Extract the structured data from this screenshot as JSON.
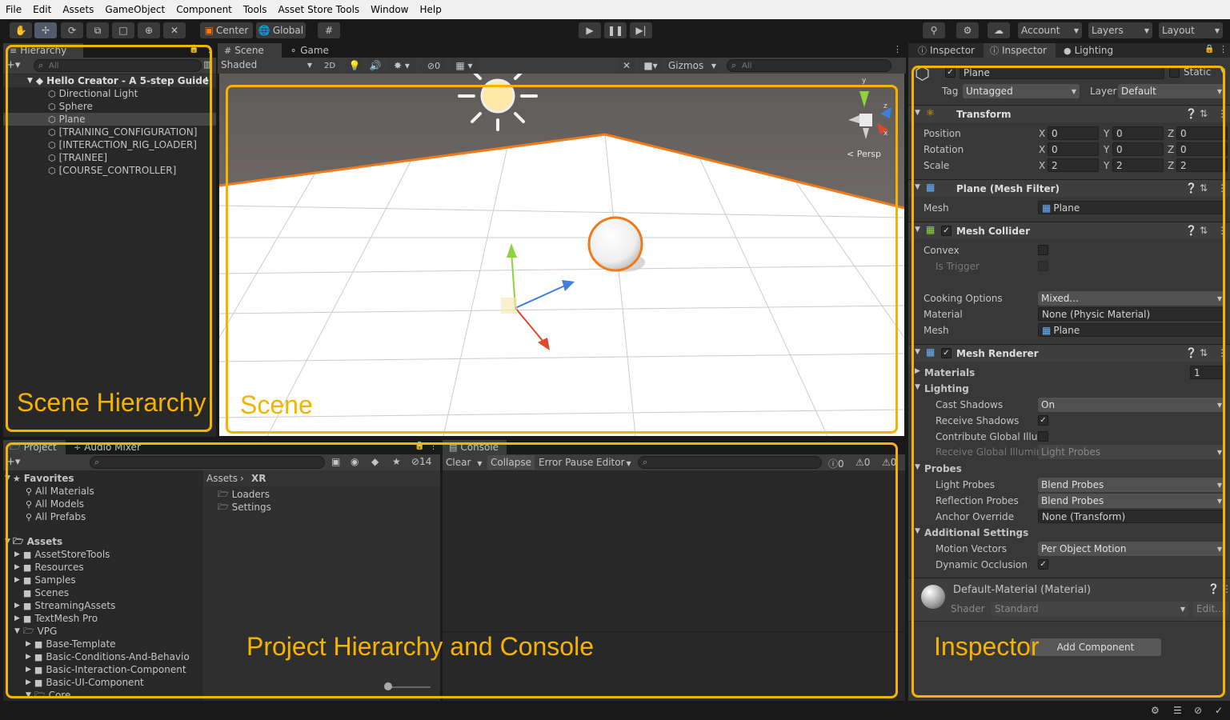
{
  "menu": [
    "File",
    "Edit",
    "Assets",
    "GameObject",
    "Component",
    "Tools",
    "Asset Store Tools",
    "Window",
    "Help"
  ],
  "toolbar": {
    "center_label": "Center",
    "global_label": "Global",
    "account_label": "Account",
    "layers_label": "Layers",
    "layout_label": "Layout"
  },
  "hierarchy": {
    "tab": "Hierarchy",
    "search_placeholder": "All",
    "scene_name": "Hello Creator - A 5-step Guide",
    "items": [
      "Directional Light",
      "Sphere",
      "Plane",
      "[TRAINING_CONFIGURATION]",
      "[INTERACTION_RIG_LOADER]",
      "[TRAINEE]",
      "[COURSE_CONTROLLER]"
    ],
    "selected_item": "Plane"
  },
  "scene": {
    "tabs": [
      "Scene",
      "Game"
    ],
    "shading": "Shaded",
    "mode_2d": "2D",
    "hidden_count": "0",
    "gizmos": "Gizmos",
    "search_placeholder": "All",
    "persp": "< Persp",
    "axis_x": "x",
    "axis_y": "y",
    "axis_z": "z"
  },
  "project": {
    "tabs": [
      "Project",
      "Audio Mixer"
    ],
    "hidden_count": "14",
    "favorites_label": "Favorites",
    "favorites": [
      "All Materials",
      "All Models",
      "All Prefabs"
    ],
    "assets_label": "Assets",
    "assets": [
      "AssetStoreTools",
      "Resources",
      "Samples",
      "Scenes",
      "StreamingAssets",
      "TextMesh Pro"
    ],
    "vpg_label": "VPG",
    "vpg_children": [
      "Base-Template",
      "Basic-Conditions-And-Behavio",
      "Basic-Interaction-Component",
      "Basic-UI-Component",
      "Core"
    ],
    "breadcrumb": [
      "Assets",
      "XR"
    ],
    "folder_items": [
      "Loaders",
      "Settings"
    ]
  },
  "console": {
    "tab": "Console",
    "clear": "Clear",
    "collapse": "Collapse",
    "error_pause": "Error Pause",
    "editor": "Editor",
    "count_info": "0",
    "count_warn": "0",
    "count_error": "0"
  },
  "inspector": {
    "tabs": [
      "Inspector",
      "Inspector",
      "Lighting"
    ],
    "object_name": "Plane",
    "static_label": "Static",
    "tag_label": "Tag",
    "tag_value": "Untagged",
    "layer_label": "Layer",
    "layer_value": "Default",
    "transform": {
      "title": "Transform",
      "position_label": "Position",
      "position": [
        "0",
        "0",
        "0"
      ],
      "rotation_label": "Rotation",
      "rotation": [
        "0",
        "0",
        "0"
      ],
      "scale_label": "Scale",
      "scale": [
        "2",
        "2",
        "2"
      ],
      "x": "X",
      "y": "Y",
      "z": "Z"
    },
    "mesh_filter": {
      "title": "Plane (Mesh Filter)",
      "mesh_label": "Mesh",
      "mesh_value": "Plane"
    },
    "mesh_collider": {
      "title": "Mesh Collider",
      "convex_label": "Convex",
      "is_trigger_label": "Is Trigger",
      "cooking_label": "Cooking Options",
      "cooking_value": "Mixed...",
      "material_label": "Material",
      "material_value": "None (Physic Material)",
      "mesh_label": "Mesh",
      "mesh_value": "Plane"
    },
    "mesh_renderer": {
      "title": "Mesh Renderer",
      "materials_label": "Materials",
      "materials_count": "1",
      "lighting_label": "Lighting",
      "cast_shadows_label": "Cast Shadows",
      "cast_shadows_value": "On",
      "receive_shadows_label": "Receive Shadows",
      "contribute_gi_label": "Contribute Global Illum",
      "receive_gi_label": "Receive Global Illumin:",
      "receive_gi_value": "Light Probes",
      "probes_label": "Probes",
      "light_probes_label": "Light Probes",
      "light_probes_value": "Blend Probes",
      "reflection_probes_label": "Reflection Probes",
      "reflection_probes_value": "Blend Probes",
      "anchor_label": "Anchor Override",
      "anchor_value": "None (Transform)",
      "additional_label": "Additional Settings",
      "motion_vectors_label": "Motion Vectors",
      "motion_vectors_value": "Per Object Motion",
      "dynamic_occlusion_label": "Dynamic Occlusion"
    },
    "material": {
      "title": "Default-Material (Material)",
      "shader_label": "Shader",
      "shader_value": "Standard",
      "edit_label": "Edit..."
    },
    "add_component": "Add Component"
  },
  "annotations": {
    "scene_hierarchy": "Scene Hierarchy",
    "scene": "Scene",
    "project_console": "Project Hierarchy and Console",
    "inspector": "Inspector"
  },
  "colors": {
    "annotation": "#f5b300",
    "selection_outline": "#f07a1a",
    "panel_bg": "#282828"
  }
}
